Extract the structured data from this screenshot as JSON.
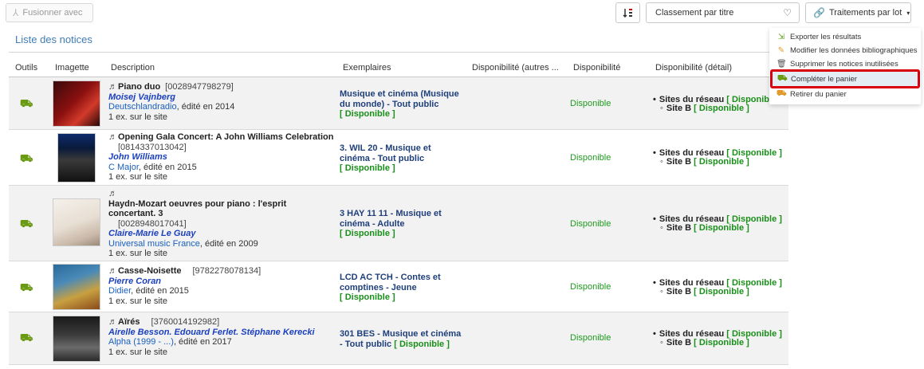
{
  "toolbar": {
    "merge_label": "Fusionner avec",
    "sort_select_value": "Classement par titre",
    "batch_label": "Traitements par lot"
  },
  "list": {
    "title": "Liste des notices",
    "columns": [
      "Outils",
      "Imagette",
      "Description",
      "Exemplaires",
      "Disponibilité (autres ...",
      "Disponibilité",
      "Disponibilité (détail)"
    ]
  },
  "records": [
    {
      "title": "Piano duo",
      "ean": "[0028947798279]",
      "authors": "Moisej Vajnberg",
      "publisher": "Deutschlandradio",
      "publisher_rest": ", édité en 2014",
      "copies": "1 ex. sur le site",
      "exemplaires": "Musique et cinéma (Musique du monde) - Tout public",
      "exemplaires_status": "[ Disponible ]",
      "dispo": "Disponible",
      "detail_network": "Sites du réseau",
      "detail_network_status": "[ Disponible ]",
      "detail_site": "Site B",
      "detail_site_status": "[ Disponible ]"
    },
    {
      "title": "Opening Gala Concert: A John Williams Celebration",
      "ean": "[0814337013042]",
      "authors": "John Williams",
      "publisher": "C Major",
      "publisher_rest": ", édité en 2015",
      "copies": "1 ex. sur le site",
      "exemplaires": "3. WIL 20 - Musique et cinéma - Tout public",
      "exemplaires_status": "[ Disponible ]",
      "dispo": "Disponible",
      "detail_network": "Sites du réseau",
      "detail_network_status": "[ Disponible ]",
      "detail_site": "Site B",
      "detail_site_status": "[ Disponible ]"
    },
    {
      "title": "Haydn-Mozart oeuvres pour piano : l'esprit concertant. 3",
      "ean": "[0028948017041]",
      "authors": "Claire-Marie Le Guay",
      "publisher": "Universal music France",
      "publisher_rest": ", édité en 2009",
      "copies": "1 ex. sur le site",
      "exemplaires": "3 HAY 11 11 - Musique et cinéma - Adulte",
      "exemplaires_status": "[ Disponible ]",
      "dispo": "Disponible",
      "detail_network": "Sites du réseau",
      "detail_network_status": "[ Disponible ]",
      "detail_site": "Site B",
      "detail_site_status": "[ Disponible ]"
    },
    {
      "title": "Casse-Noisette",
      "ean": "[9782278078134]",
      "authors": "Pierre Coran",
      "publisher": "Didier",
      "publisher_rest": ", édité en 2015",
      "copies": "1 ex. sur le site",
      "exemplaires": "LCD AC TCH - Contes et comptines - Jeune",
      "exemplaires_status": "[ Disponible ]",
      "dispo": "Disponible",
      "detail_network": "Sites du réseau",
      "detail_network_status": "[ Disponible ]",
      "detail_site": "Site B",
      "detail_site_status": "[ Disponible ]"
    },
    {
      "title": "Aïrés",
      "ean": "[3760014192982]",
      "authors": "Airelle Besson. Edouard Ferlet. Stéphane Kerecki",
      "publisher": "Alpha (1999 - ...)",
      "publisher_rest": ", édité en 2017",
      "copies": "1 ex. sur le site",
      "exemplaires": "301 BES - Musique et cinéma - Tout public",
      "exemplaires_status": "[ Disponible ]",
      "dispo": "Disponible",
      "detail_network": "Sites du réseau",
      "detail_network_status": "[ Disponible ]",
      "detail_site": "Site B",
      "detail_site_status": "[ Disponible ]"
    }
  ],
  "batch_menu": [
    {
      "label": "Exporter les résultats",
      "icon": "export-icon"
    },
    {
      "label": "Modifier les données bibliographiques",
      "icon": "pencil-icon"
    },
    {
      "label": "Supprimer les notices inutilisées",
      "icon": "trash-icon"
    },
    {
      "label": "Compléter le panier",
      "icon": "cart-add-icon",
      "highlighted": true
    },
    {
      "label": "Retirer du panier",
      "icon": "cart-remove-icon"
    }
  ],
  "colors": {
    "link_blue": "#1a3fbf",
    "available_green": "#1f9a1f",
    "cart_green": "#6a9a12",
    "highlight_red": "#d9000d",
    "title_blue": "#3c7db8"
  }
}
